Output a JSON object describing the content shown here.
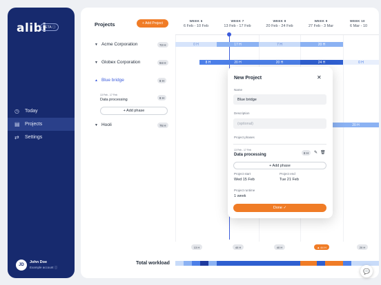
{
  "sidebar": {
    "logo": "alibi",
    "beta": "BETA ⓘ",
    "nav": [
      {
        "icon": "clock-icon",
        "glyph": "◷",
        "label": "Today"
      },
      {
        "icon": "projects-icon",
        "glyph": "▤",
        "label": "Projects"
      },
      {
        "icon": "settings-icon",
        "glyph": "⇄",
        "label": "Settings"
      }
    ],
    "user": {
      "initials": "JD",
      "name": "John Doe",
      "account": "Example account ⓘ"
    }
  },
  "main": {
    "title": "Projects",
    "add_project": "+ Add Project",
    "weeks": [
      {
        "label": "WEEK 6",
        "dates": "6 Feb - 10 Feb"
      },
      {
        "label": "WEEK 7",
        "dates": "13 Feb - 17 Feb"
      },
      {
        "label": "WEEK 8",
        "dates": "20 Feb - 24 Feb"
      },
      {
        "label": "WEEK 9",
        "dates": "27 Feb - 3 Mar"
      },
      {
        "label": "WEEK 10",
        "dates": "6 Mar - 10"
      }
    ],
    "projects": [
      {
        "name": "Acme Corporation",
        "hours": "72 H",
        "bars": [
          "0 H",
          "17 H",
          "7 H",
          "20 H"
        ]
      },
      {
        "name": "Globex Corporation",
        "hours": "94 H",
        "bars": [
          "8 H",
          "20 H",
          "20 H",
          "24 H",
          "0 H"
        ]
      },
      {
        "name": "Blue bridge",
        "hours": "8 H",
        "phase_dates": "13 Feb - 17 Feb",
        "phase_name": "Data processing",
        "phase_hours": "8 H",
        "add_phase": "+ Add phase"
      },
      {
        "name": "Hooli",
        "hours": "76 H",
        "bars": [
          "20 H"
        ]
      }
    ],
    "totals": [
      "13 H",
      "40 H",
      "40 H",
      "▲ 44 H",
      "20 H"
    ],
    "total_label": "Total workload"
  },
  "modal": {
    "title": "New Project",
    "close": "✕",
    "name_label": "Name",
    "name_value": "Blue bridge",
    "desc_label": "Description",
    "desc_placeholder": "(optional)",
    "phases_label": "Project phases",
    "phase_dates": "13 Feb - 17 Feb",
    "phase_name": "Data processing",
    "phase_hours": "8 H",
    "add_phase": "+ Add phase",
    "start_label": "Project start",
    "start_value": "Wed 15 Feb",
    "end_label": "Project end",
    "end_value": "Tue 21 Feb",
    "runtime_label": "Project runtime",
    "runtime_value": "1 week",
    "done": "Done ✓"
  }
}
